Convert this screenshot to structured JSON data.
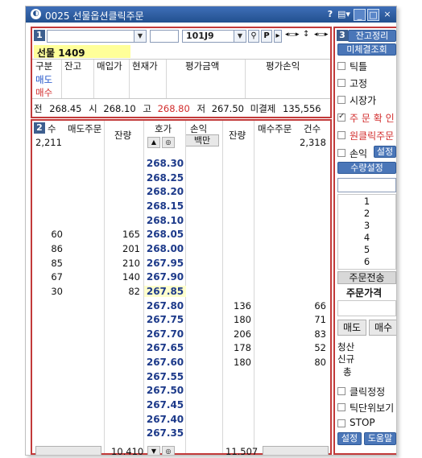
{
  "window": {
    "title": "0025 선물옵션클릭주문",
    "help": "?",
    "menu": "▤▾",
    "minimize": "_",
    "restore": "□",
    "close": "×"
  },
  "panel1": {
    "badge": "1",
    "code": "101J9",
    "p_label": "P",
    "name": "선물 1409",
    "headers": [
      "구분",
      "잔고",
      "매입가",
      "현재가",
      "평가금액",
      "평가손익"
    ],
    "row_sell": "매도",
    "row_buy": "매수",
    "quote": {
      "prev_label": "전",
      "prev": "268.45",
      "open_label": "시",
      "open": "268.10",
      "high_label": "고",
      "high": "268.80",
      "low_label": "저",
      "low": "267.50",
      "unsettled_label": "미결제",
      "unsettled": "135,556"
    }
  },
  "panel2": {
    "badge": "2",
    "col_count_left": "수",
    "col_sell_order": "매도주문",
    "col_remain_left": "잔량",
    "col_price": "호가",
    "col_pl": "손익",
    "col_pl_unit": "백만",
    "col_remain_right": "잔량",
    "col_buy_order": "매수주문",
    "col_count_right": "건수",
    "total_count_left": "2,211",
    "total_count_right": "2,318",
    "footer_remain_left": "10,410",
    "footer_remain_right": "11,507"
  },
  "ladder": [
    {
      "price": "268.30"
    },
    {
      "price": "268.25"
    },
    {
      "price": "268.20"
    },
    {
      "price": "268.15"
    },
    {
      "price": "268.10"
    },
    {
      "price": "268.05",
      "count": "60",
      "remain": "165"
    },
    {
      "price": "268.00",
      "count": "86",
      "remain": "201"
    },
    {
      "price": "267.95",
      "count": "85",
      "remain": "210"
    },
    {
      "price": "267.90",
      "count": "67",
      "remain": "140"
    },
    {
      "price": "267.85",
      "count": "30",
      "remain": "82",
      "current": true
    },
    {
      "price": "267.80",
      "bid_remain": "136",
      "bid_count": "66"
    },
    {
      "price": "267.75",
      "bid_remain": "180",
      "bid_count": "71"
    },
    {
      "price": "267.70",
      "bid_remain": "206",
      "bid_count": "83"
    },
    {
      "price": "267.65",
      "bid_remain": "178",
      "bid_count": "52"
    },
    {
      "price": "267.60",
      "bid_remain": "180",
      "bid_count": "80"
    },
    {
      "price": "267.55"
    },
    {
      "price": "267.50"
    },
    {
      "price": "267.45"
    },
    {
      "price": "267.40"
    },
    {
      "price": "267.35"
    }
  ],
  "panel3": {
    "badge": "3",
    "settle_btn": "잔고정리",
    "unsettled_btn": "미체결조회",
    "opts": [
      "틱틀",
      "고정",
      "시장가",
      "주 문 확 인",
      "원클릭주문",
      "손익"
    ],
    "set_btn": "설정",
    "qty_btn": "수량설정",
    "qty_list": [
      "1",
      "2",
      "3",
      "4",
      "5",
      "6"
    ],
    "send_btn": "주문전송",
    "order_price_label": "주문가격",
    "sell_btn": "매도",
    "buy_btn": "매수",
    "clear_label": "청산",
    "new_label": "신규",
    "total_label": "총",
    "lower_opts": [
      "클릭정정",
      "틱단위보기",
      "STOP"
    ],
    "setup_btn": "설정",
    "help_btn": "도움말"
  },
  "colors": {
    "title_bar": "#2e5ea3",
    "panel_border": "#c23a3a",
    "price_text": "#1d3a8a",
    "name_highlight": "#ffff99",
    "current_price_bg": "#ffffcc",
    "sell_color": "#1e50c8",
    "buy_color": "#d22c2c"
  }
}
